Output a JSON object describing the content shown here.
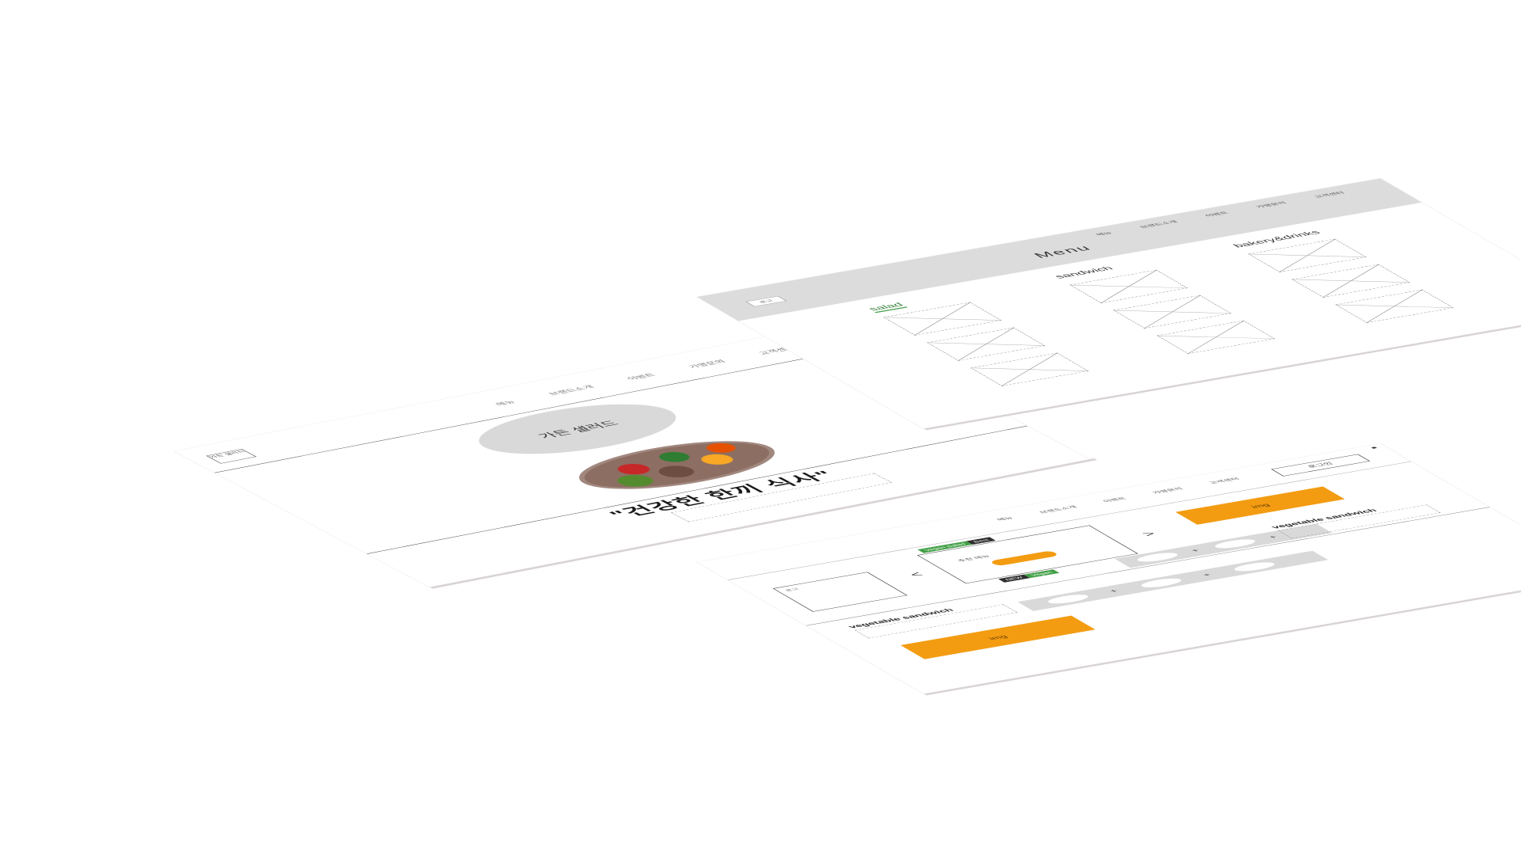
{
  "home": {
    "logo": "가든 샐러드",
    "nav": [
      "메뉴",
      "브랜드소개",
      "이벤트",
      "가맹문의",
      "고객센터"
    ],
    "nav_icon": "menu-icon",
    "hero_circle": "가든 샐러드",
    "hero_title": "\"건강한 한끼 식사\""
  },
  "menu": {
    "logo": "로고",
    "title": "Menu",
    "nav": [
      "메뉴",
      "브랜드소개",
      "이벤트",
      "가맹문의",
      "고객센터"
    ],
    "columns": [
      "salad",
      "sandwich",
      "bakery&drinks"
    ]
  },
  "detail": {
    "nav": [
      "메뉴",
      "브랜드소개",
      "이벤트",
      "가맹문의",
      "고객센터"
    ],
    "header_button": "로그인",
    "left_label": "로고",
    "card_caption": "추천 메뉴",
    "tags_top": [
      "Vegan Salad",
      "Best"
    ],
    "tags_mid": [
      "NEW",
      "Vegan"
    ],
    "orange_top": "img",
    "orange_bottom": "img",
    "product_1": "vegetable sandwich",
    "product_2": "vegetable sandwich",
    "prev": "<",
    "next": ">",
    "plus": "+",
    "accent_orange": "#f39c12",
    "accent_green": "#43a047"
  }
}
